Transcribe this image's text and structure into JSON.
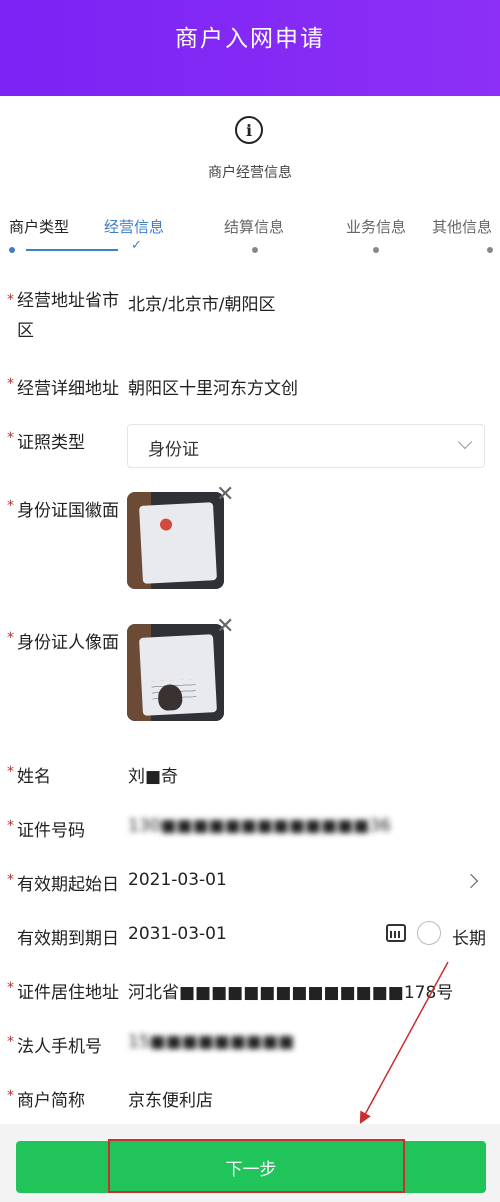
{
  "header": {
    "title": "商户入网申请"
  },
  "section": {
    "title": "商户经营信息"
  },
  "steps": [
    {
      "label": "商户类型",
      "state": "done"
    },
    {
      "label": "经营信息",
      "state": "active"
    },
    {
      "label": "结算信息",
      "state": "pending"
    },
    {
      "label": "业务信息",
      "state": "pending"
    },
    {
      "label": "其他信息",
      "state": "pending"
    }
  ],
  "form": {
    "address_region": {
      "label": "经营地址省市区",
      "value": "北京/北京市/朝阳区"
    },
    "address_detail": {
      "label": "经营详细地址",
      "value": "朝阳区十里河东方文创"
    },
    "license_type": {
      "label": "证照类型",
      "value": "身份证"
    },
    "id_front": {
      "label": "身份证国徽面"
    },
    "id_back": {
      "label": "身份证人像面"
    },
    "name": {
      "label": "姓名",
      "value": "刘■奇"
    },
    "id_number": {
      "label": "证件号码",
      "value": "130■■■■■■■■■■■■■36"
    },
    "valid_from": {
      "label": "有效期起始日",
      "value": "2021-03-01"
    },
    "valid_to": {
      "label": "有效期到期日",
      "value": "2031-03-01",
      "long_term_label": "长期"
    },
    "residence": {
      "label": "证件居住地址",
      "value": "河北省■■■■■■■■■■■■■■178号"
    },
    "legal_phone": {
      "label": "法人手机号",
      "value": "15■■■■■■■■■"
    },
    "short_name": {
      "label": "商户简称",
      "value": "京东便利店"
    }
  },
  "footer": {
    "next_label": "下一步"
  },
  "colors": {
    "header": "#7a23f4",
    "accent": "#3d7ec9",
    "button": "#21c35b",
    "required": "#c52b2b",
    "annotation": "#c8302d"
  }
}
